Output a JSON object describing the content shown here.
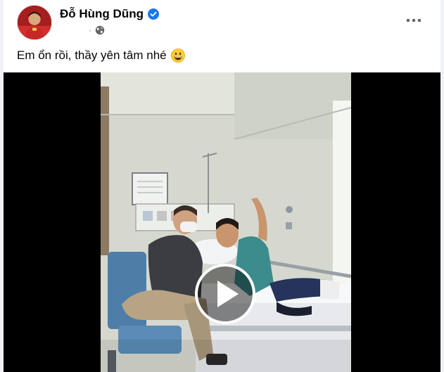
{
  "post": {
    "author": {
      "name": "Đỗ Hùng Dũng",
      "verified": true,
      "avatar": "avatar"
    },
    "meta": {
      "dot": "·",
      "audience_icon": "globe-icon"
    },
    "more_icon": "more-options-icon",
    "text": "Em ổn rồi, thầy yên tâm nhé",
    "emoji": "grinning-face-emoji",
    "video": {
      "play_icon": "play-icon"
    }
  },
  "colors": {
    "brand_blue": "#1877f2",
    "text_primary": "#050505",
    "text_secondary": "#65676b",
    "video_bg": "#000000"
  }
}
